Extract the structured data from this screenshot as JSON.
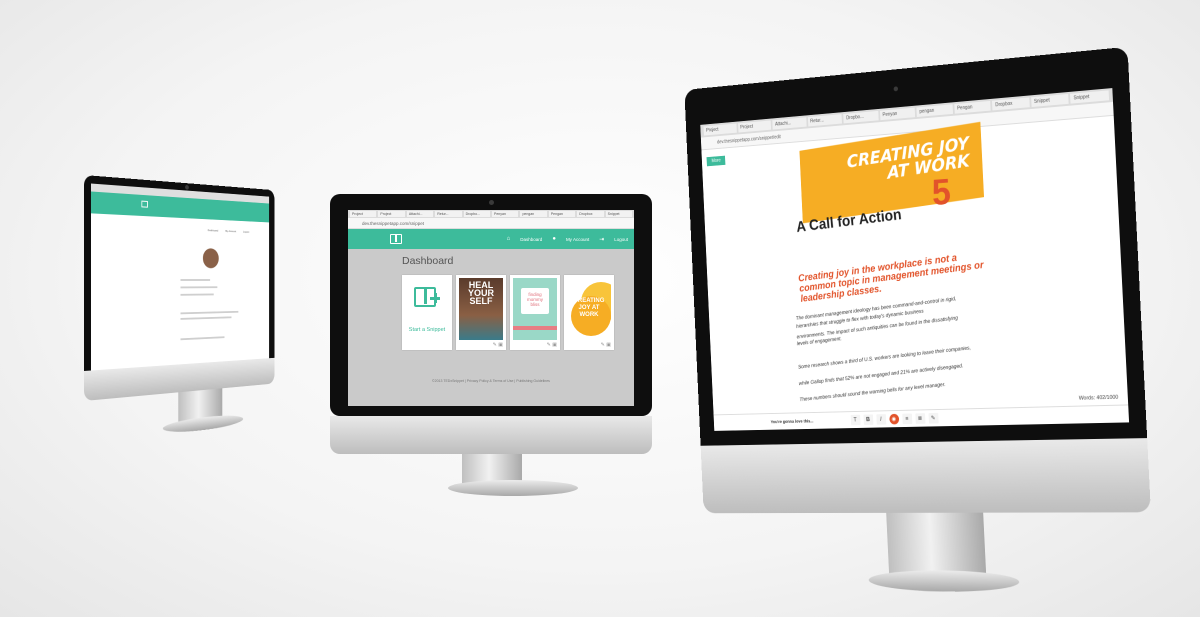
{
  "left_screen": {
    "nav_items": [
      "Dashboard",
      "My Account",
      "Logout"
    ]
  },
  "center_screen": {
    "url": "dev.thesnippetapp.com/snippet",
    "tabs": [
      "Project",
      "Project",
      "Attachi...",
      "Retur...",
      "Dropbo...",
      "Penyan",
      "pengan",
      "Pengan",
      "Dropbox",
      "Snippet"
    ],
    "nav": {
      "dashboard": "Dashboard",
      "my_account": "My Account",
      "logout": "Logout"
    },
    "page_title": "Dashboard",
    "start_snippet": "Start a Snippet",
    "cards": [
      {
        "title_lines": [
          "HEAL",
          "YOUR",
          "SELF"
        ]
      },
      {
        "title_lines": [
          "finding",
          "mommy",
          "bliss"
        ]
      },
      {
        "title_lines": [
          "CREATING",
          "JOY AT",
          "WORK"
        ]
      }
    ],
    "footer": "©2013 TEDxSnippet | Privacy Policy & Terms of Use | Publishing Guidelines"
  },
  "right_screen": {
    "url": "dev.thesnippetapp.com/snippet/edit",
    "tabs": [
      "Project",
      "Project",
      "Attachi...",
      "Retur...",
      "Dropbo...",
      "Penyan",
      "pengan",
      "Pengan",
      "Dropbox",
      "Snippet",
      "Snippet"
    ],
    "more_button": "More",
    "banner_lines": [
      "CREATING JOY",
      "AT WORK"
    ],
    "number": "5",
    "subtitle": "A Call for Action",
    "headline": "Creating joy in the workplace is not a common topic in management meetings or leadership classes.",
    "paragraphs": [
      "The dominant management ideology has been command-and-control in rigid,",
      "hierarchies that struggle to flex with today's dynamic business",
      "environments. The impact of such antiquities can be found in the dissatisfying",
      "levels of engagement.",
      "Some research shows a third of U.S. workers are looking to leave their companies,",
      "while Gallup finds that 52% are not engaged and 21% are actively disengaged.",
      "These numbers should sound the warning bells for any level manager."
    ],
    "toolbar_caption": "You're gonna love this...",
    "word_count": "Words: 402/1000",
    "toolbar_buttons": [
      "T",
      "B",
      "I",
      "≡",
      "≣",
      "✎"
    ]
  },
  "colors": {
    "teal": "#3dbb9b",
    "orange": "#f6ad24",
    "red": "#e2532a"
  }
}
